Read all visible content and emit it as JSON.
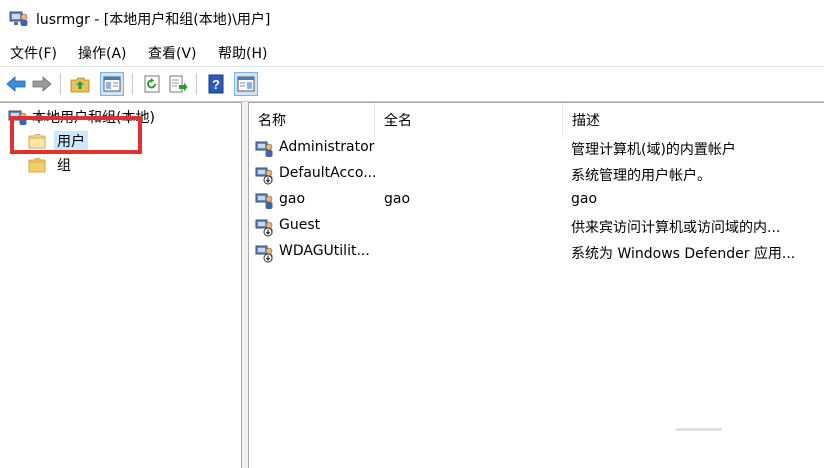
{
  "window": {
    "title": "lusrmgr - [本地用户和组(本地)\\用户]",
    "app_icon": "computer-users-icon"
  },
  "menu": [
    {
      "label": "文件(F)"
    },
    {
      "label": "操作(A)"
    },
    {
      "label": "查看(V)"
    },
    {
      "label": "帮助(H)"
    }
  ],
  "toolbar": {
    "buttons": [
      {
        "icon": "back-arrow-icon"
      },
      {
        "icon": "forward-arrow-icon"
      },
      {
        "icon": "up-folder-icon"
      },
      {
        "icon": "show-hide-tree-icon",
        "active": true
      },
      {
        "icon": "refresh-icon"
      },
      {
        "icon": "export-list-icon"
      },
      {
        "icon": "help-icon"
      },
      {
        "icon": "action-pane-icon",
        "active": true
      }
    ]
  },
  "tree": {
    "root": {
      "label": "本地用户和组(本地)",
      "icon": "computer-users-icon"
    },
    "children": [
      {
        "label": "用户",
        "icon": "folder-icon",
        "selected": true
      },
      {
        "label": "组",
        "icon": "folder-icon",
        "selected": false
      }
    ]
  },
  "list": {
    "columns": [
      "名称",
      "全名",
      "描述"
    ],
    "rows": [
      {
        "name": "Administrator",
        "full_name": "",
        "description": "管理计算机(域)的内置帐户",
        "disabled": false
      },
      {
        "name": "DefaultAcco...",
        "full_name": "",
        "description": "系统管理的用户帐户。",
        "disabled": true
      },
      {
        "name": "gao",
        "full_name": "gao",
        "description": "gao",
        "disabled": false
      },
      {
        "name": "Guest",
        "full_name": "",
        "description": "供来宾访问计算机或访问域的内...",
        "disabled": true
      },
      {
        "name": "WDAGUtilit...",
        "full_name": "",
        "description": "系统为 Windows Defender 应用...",
        "disabled": true
      }
    ]
  },
  "colors": {
    "highlight_box": "#e03030",
    "selection": "#cce8ff",
    "toolbar_active": "#cfe4f7"
  }
}
